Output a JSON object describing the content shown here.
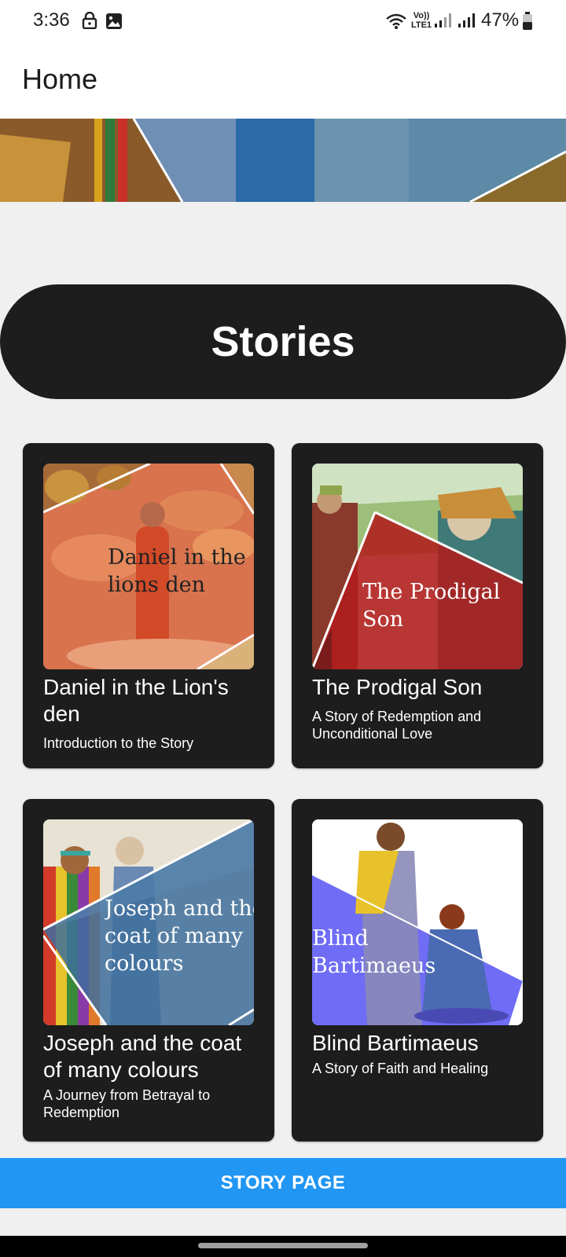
{
  "status_bar": {
    "time": "3:36",
    "volte": "Vo))\nLTE1",
    "battery": "47%"
  },
  "app_bar": {
    "title": "Home"
  },
  "section": {
    "title": "Stories"
  },
  "cards": [
    {
      "image_caption": "Daniel in the\nlions den",
      "title": "Daniel in the Lion's den",
      "subtitle": "Introduction to the Story"
    },
    {
      "image_caption": "The Prodigal\nSon",
      "title": "The Prodigal Son",
      "subtitle": "A Story of Redemption and Unconditional Love"
    },
    {
      "image_caption": "Joseph and the\ncoat of many\ncolours",
      "title": "Joseph and the coat of many colours",
      "subtitle": "A Journey from Betrayal to Redemption"
    },
    {
      "image_caption": "Blind\nBartimaeus",
      "title": "Blind Bartimaeus",
      "subtitle": "A Story of Faith and Healing"
    }
  ],
  "button": {
    "label": "STORY PAGE"
  },
  "colors": {
    "accent": "#2196f3",
    "card_bg": "#1d1d1d",
    "page_bg": "#f0f0f0"
  }
}
